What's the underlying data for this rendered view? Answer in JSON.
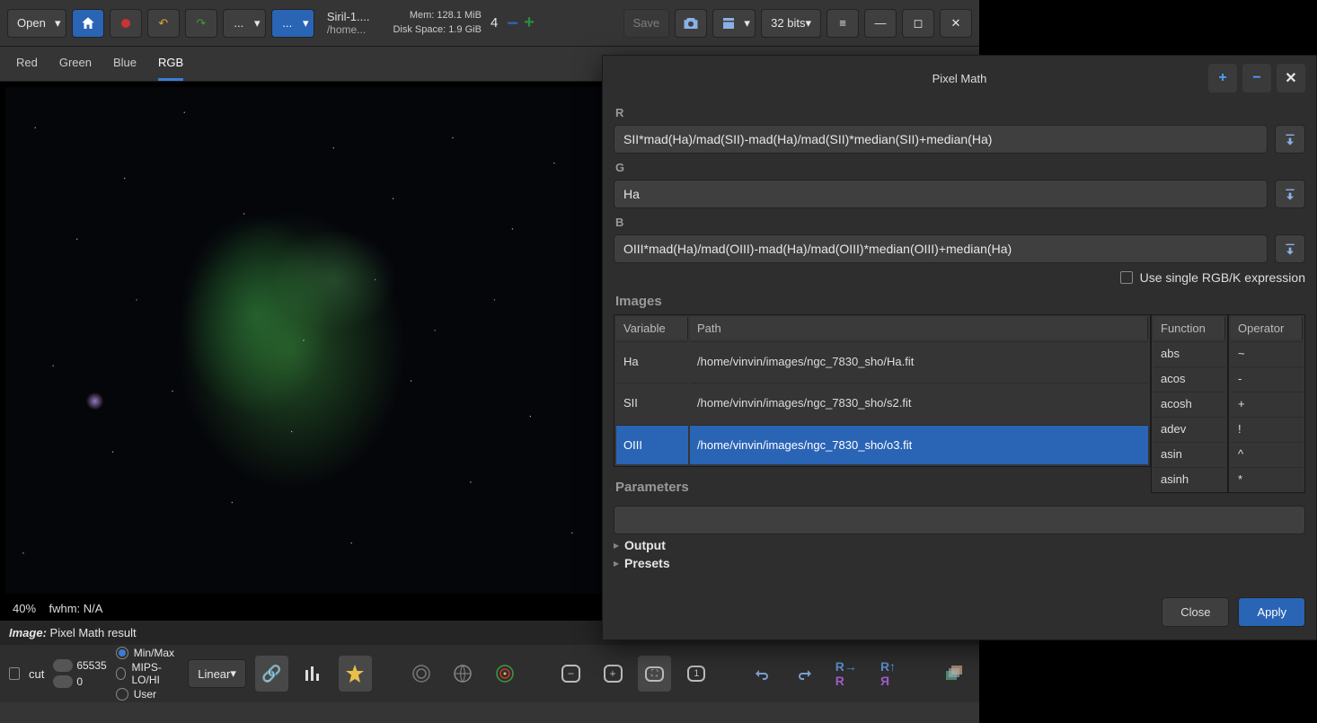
{
  "toolbar": {
    "open": "Open",
    "title": "Siril-1....",
    "subtitle": "/home...",
    "mem_label": "Mem:",
    "mem_value": "128.1 MiB",
    "disk_label": "Disk Space:",
    "disk_value": "1.9 GiB",
    "zoom_value": "4",
    "save": "Save",
    "bits": "32 bits",
    "more1": "...",
    "more2": "..."
  },
  "tabs": [
    "Red",
    "Green",
    "Blue",
    "RGB"
  ],
  "tabs_active": 3,
  "viewer": {
    "zoom_pct": "40%",
    "fwhm": "fwhm:  N/A",
    "image_label": "Image:",
    "image_value": "Pixel Math result"
  },
  "bottom": {
    "cut": "cut",
    "hi": "65535",
    "lo": "0",
    "mode_minmax": "Min/Max",
    "mode_mips": "MIPS-LO/HI",
    "mode_user": "User",
    "stretch": "Linear"
  },
  "dialog": {
    "title": "Pixel Math",
    "R": "R",
    "G": "G",
    "B": "B",
    "r_expr": "SII*mad(Ha)/mad(SII)-mad(Ha)/mad(SII)*median(SII)+median(Ha)",
    "g_expr": "Ha",
    "b_expr": "OIII*mad(Ha)/mad(OIII)-mad(Ha)/mad(OIII)*median(OIII)+median(Ha)",
    "use_single": "Use single RGB/K expression",
    "images_label": "Images",
    "col_variable": "Variable",
    "col_path": "Path",
    "col_function": "Function",
    "col_operator": "Operator",
    "images": [
      {
        "var": "Ha",
        "path": "/home/vinvin/images/ngc_7830_sho/Ha.fit",
        "sel": false
      },
      {
        "var": "SII",
        "path": "/home/vinvin/images/ngc_7830_sho/s2.fit",
        "sel": false
      },
      {
        "var": "OIII",
        "path": "/home/vinvin/images/ngc_7830_sho/o3.fit",
        "sel": true
      }
    ],
    "functions": [
      "abs",
      "acos",
      "acosh",
      "adev",
      "asin",
      "asinh"
    ],
    "operators": [
      "~",
      "-",
      "+",
      "!",
      "^",
      "*"
    ],
    "parameters_label": "Parameters",
    "output": "Output",
    "presets": "Presets",
    "close": "Close",
    "apply": "Apply"
  }
}
